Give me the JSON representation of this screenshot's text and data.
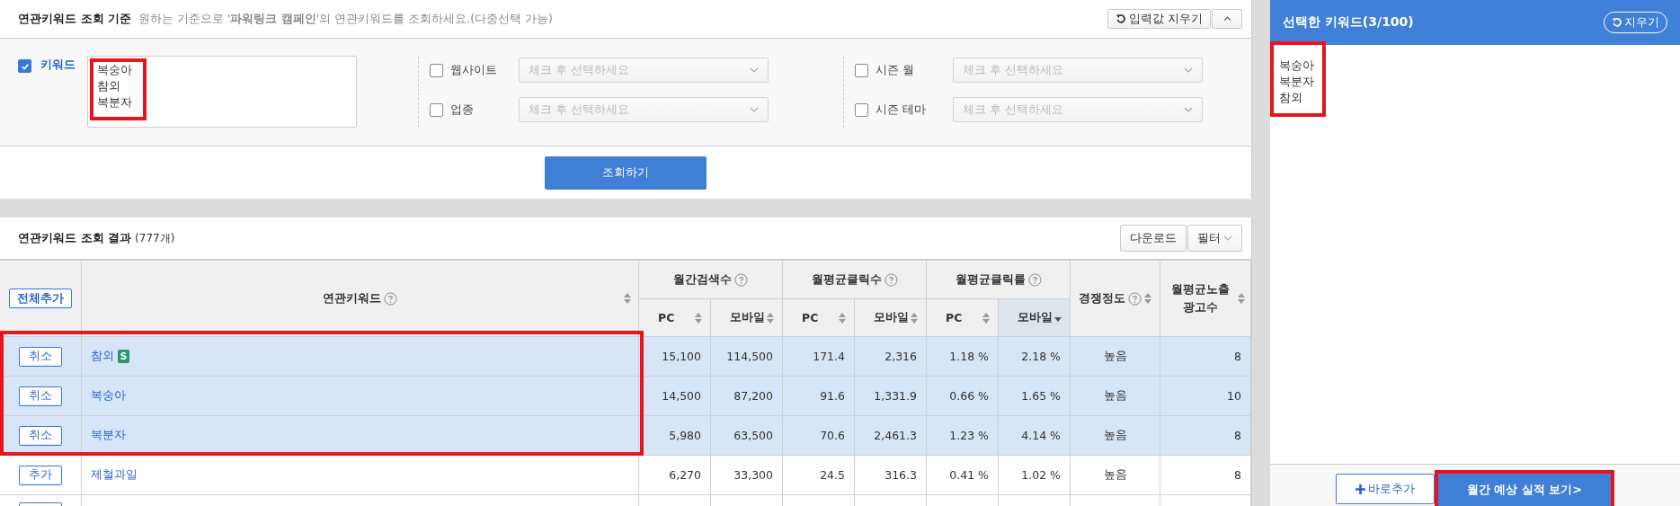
{
  "criteria": {
    "title": "연관키워드 조회 기준",
    "description": "원하는 기준으로 '**파워링크 캠페인**'의 연관키워드를 조회하세요.(다중선택 가능)",
    "reset_button": "입력값 지우기",
    "keyword_filter": {
      "label": "키워드",
      "checked": true,
      "value": "복숭아\n참외\n복분자"
    },
    "filters": [
      {
        "label": "웹사이트",
        "checked": false,
        "placeholder": "체크 후 선택하세요"
      },
      {
        "label": "업종",
        "checked": false,
        "placeholder": "체크 후 선택하세요"
      },
      {
        "label": "시즌 월",
        "checked": false,
        "placeholder": "체크 후 선택하세요"
      },
      {
        "label": "시즌 테마",
        "checked": false,
        "placeholder": "체크 후 선택하세요"
      }
    ],
    "search_button": "조회하기"
  },
  "results": {
    "title": "연관키워드 조회 결과",
    "count": "(777개)",
    "download_button": "다운로드",
    "filter_button": "필터",
    "add_all_button": "전체추가",
    "keyword_header": "연관키워드",
    "groups": [
      {
        "label": "월간검색수",
        "subs": [
          {
            "label": "PC",
            "sorted": false
          },
          {
            "label": "모바일",
            "sorted": false
          }
        ]
      },
      {
        "label": "월평균클릭수",
        "subs": [
          {
            "label": "PC",
            "sorted": false
          },
          {
            "label": "모바일",
            "sorted": false
          }
        ]
      },
      {
        "label": "월평균클릭률",
        "subs": [
          {
            "label": "PC",
            "sorted": false
          },
          {
            "label": "모바일",
            "sorted": true
          }
        ]
      }
    ],
    "competition_header": "경쟁정도",
    "ads_header": "월평균노출 광고수",
    "rows": [
      {
        "action": "취소",
        "keyword": "참외",
        "badge": "S",
        "selected": true,
        "cells": [
          "15,100",
          "114,500",
          "171.4",
          "2,316",
          "1.18 %",
          "2.18 %",
          "높음",
          "8"
        ]
      },
      {
        "action": "취소",
        "keyword": "복숭아",
        "selected": true,
        "cells": [
          "14,500",
          "87,200",
          "91.6",
          "1,331.9",
          "0.66 %",
          "1.65 %",
          "높음",
          "10"
        ]
      },
      {
        "action": "취소",
        "keyword": "복분자",
        "selected": true,
        "cells": [
          "5,980",
          "63,500",
          "70.6",
          "2,461.3",
          "1.23 %",
          "4.14 %",
          "높음",
          "8"
        ]
      },
      {
        "action": "추가",
        "keyword": "제철과일",
        "selected": false,
        "cells": [
          "6,270",
          "33,300",
          "24.5",
          "316.3",
          "0.41 %",
          "1.02 %",
          "높음",
          "8"
        ]
      }
    ]
  },
  "selected_panel": {
    "title": "선택한 키워드(3/100)",
    "reset_button": "지우기",
    "value": "복숭아\n복분자\n참외",
    "add_button": "바로추가",
    "forecast_button": "월간 예상 실적 보기>"
  }
}
